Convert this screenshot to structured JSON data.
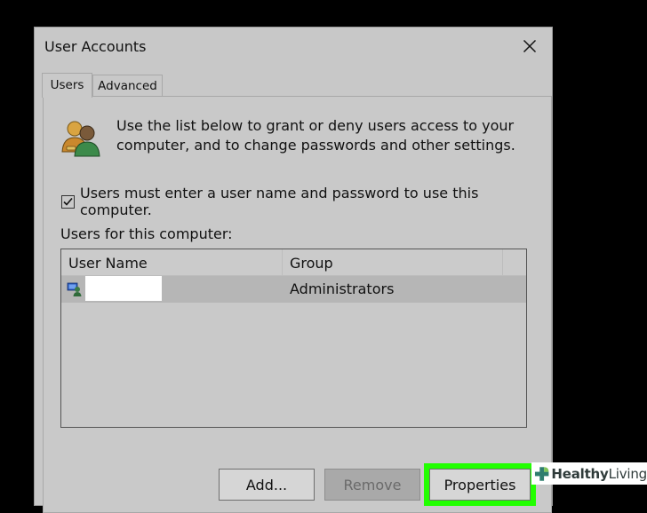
{
  "window": {
    "title": "User Accounts",
    "close_icon": "close-icon"
  },
  "tabs": [
    {
      "label": "Users",
      "active": true
    },
    {
      "label": "Advanced",
      "active": false
    }
  ],
  "intro": {
    "icon": "users-icon",
    "text": "Use the list below to grant or deny users access to your computer, and to change passwords and other settings."
  },
  "login_required": {
    "label": "Users must enter a user name and password to use this computer.",
    "checked": true
  },
  "users_list": {
    "label": "Users for this computer:",
    "columns": [
      "User Name",
      "Group"
    ],
    "rows": [
      {
        "user_name": "",
        "group": "Administrators",
        "icon": "user-account-icon"
      }
    ]
  },
  "buttons": {
    "add": "Add...",
    "remove": "Remove",
    "properties": "Properties"
  },
  "colors": {
    "highlight": "#22ff00",
    "dialog_bg": "#c8c8c8",
    "background": "#000000"
  },
  "watermark": {
    "brand_bold": "Healthy",
    "brand_light": "Living",
    "icon": "cross-leaf-icon"
  }
}
